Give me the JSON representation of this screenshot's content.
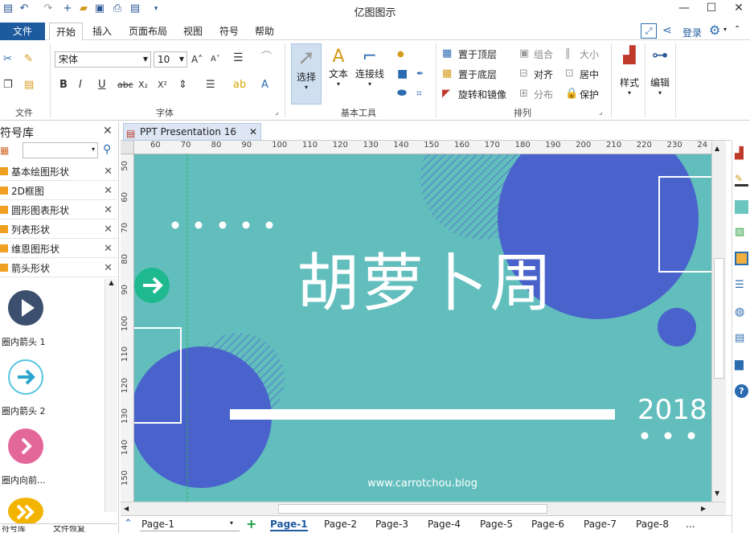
{
  "window": {
    "title": "亿图图示",
    "minimize": "—",
    "maximize": "☐",
    "close": "✕"
  },
  "menu": {
    "file": "文件",
    "tabs": [
      "开始",
      "插入",
      "页面布局",
      "视图",
      "符号",
      "帮助"
    ],
    "login": "登录"
  },
  "ribbon": {
    "groups": {
      "file": "文件",
      "font": "字体",
      "basic_tools": "基本工具",
      "arrange": "排列"
    },
    "font_name": "宋体",
    "font_size": "10",
    "tools": {
      "select": "选择",
      "text": "文本",
      "connector": "连接线"
    },
    "arrange": {
      "bring_front": "置于顶层",
      "send_back": "置于底层",
      "rotate_mirror": "旋转和镜像",
      "group": "组合",
      "align": "对齐",
      "distribute": "分布",
      "size": "大小",
      "center": "居中",
      "protect": "保护"
    },
    "style": "样式",
    "edit": "编辑"
  },
  "library": {
    "title": "符号库",
    "items": [
      "基本绘图形状",
      "2D框图",
      "圆形图表形状",
      "列表形状",
      "维恩图形状",
      "箭头形状"
    ],
    "shapes": [
      "圈内箭头 1",
      "圈内箭头 2",
      "圈内向前..."
    ],
    "bottom_tabs": [
      "符号库",
      "文件恢复"
    ]
  },
  "document": {
    "tab_title": "PPT Presentation 16",
    "ruler_h": [
      "60",
      "70",
      "80",
      "90",
      "100",
      "110",
      "120",
      "130",
      "140",
      "150",
      "160",
      "170",
      "180",
      "190",
      "200",
      "210",
      "220",
      "230",
      "24"
    ],
    "ruler_v": [
      "50",
      "60",
      "70",
      "80",
      "90",
      "100",
      "110",
      "120",
      "130",
      "140",
      "150"
    ]
  },
  "slide": {
    "title": "胡萝卜周",
    "year": "2018",
    "url": "www.carrotchou.blog"
  },
  "pages": {
    "current": "Page-1",
    "add": "+",
    "tabs": [
      "Page-1",
      "Page-2",
      "Page-3",
      "Page-4",
      "Page-5",
      "Page-6",
      "Page-7",
      "Page-8",
      "..."
    ]
  },
  "colors": {
    "accent": "#1e5a9e",
    "slide_bg": "#62bebd",
    "circle": "#4a63cc",
    "teal_arrow": "#1fb98f"
  }
}
